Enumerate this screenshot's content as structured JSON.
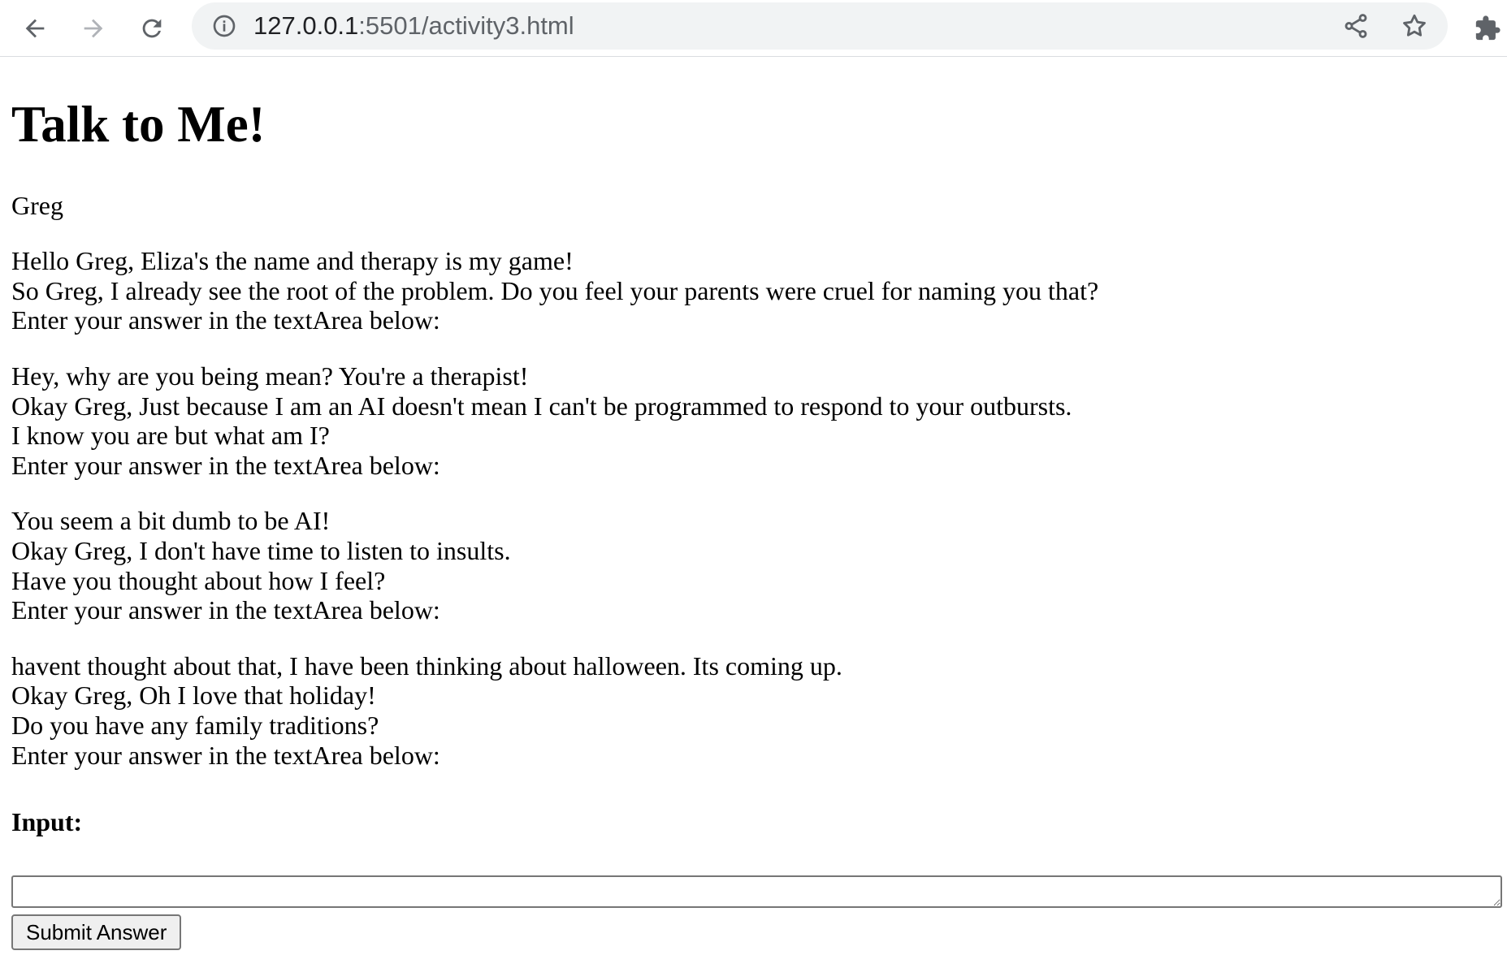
{
  "browser": {
    "url_host": "127.0.0.1",
    "url_path": ":5501/activity3.html"
  },
  "page": {
    "title": "Talk to Me!",
    "user_name": "Greg",
    "conversation": [
      {
        "lines": [
          "Hello Greg, Eliza's the name and therapy is my game!",
          "So Greg, I already see the root of the problem. Do you feel your parents were cruel for naming you that?",
          "Enter your answer in the textArea below:"
        ]
      },
      {
        "lines": [
          "Hey, why are you being mean? You're a therapist!",
          "Okay Greg, Just because I am an AI doesn't mean I can't be programmed to respond to your outbursts.",
          "I know you are but what am I?",
          "Enter your answer in the textArea below:"
        ]
      },
      {
        "lines": [
          "You seem a bit dumb to be AI!",
          "Okay Greg, I don't have time to listen to insults.",
          "Have you thought about how I feel?",
          "Enter your answer in the textArea below:"
        ]
      },
      {
        "lines": [
          "havent thought about that, I have been thinking about halloween. Its coming up.",
          "Okay Greg, Oh I love that holiday!",
          "Do you have any family traditions?",
          "Enter your answer in the textArea below:"
        ]
      }
    ],
    "input_label": "Input:",
    "input_value": "",
    "submit_label": "Submit Answer"
  },
  "icons": {
    "back": "arrow-left-icon",
    "forward": "arrow-right-icon",
    "reload": "reload-icon",
    "site_info": "info-icon",
    "share": "share-icon",
    "bookmark": "star-icon",
    "extensions": "puzzle-icon"
  }
}
